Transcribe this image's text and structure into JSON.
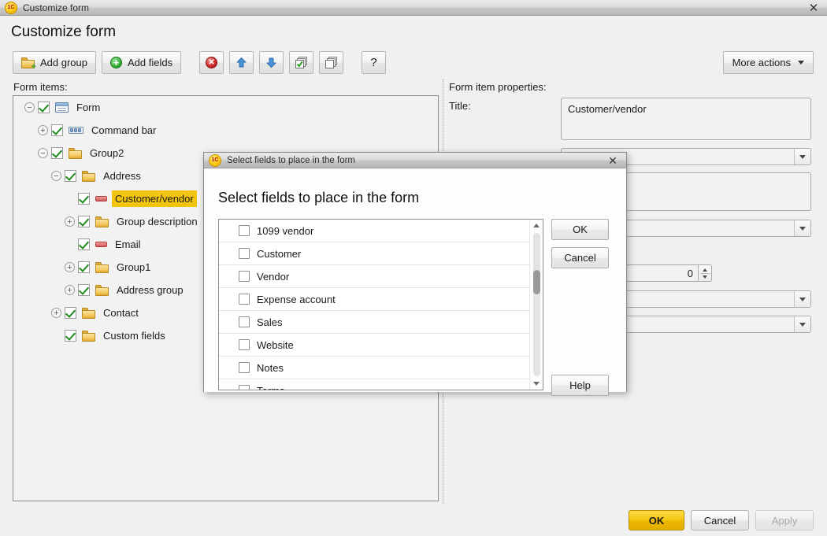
{
  "window": {
    "title": "Customize form",
    "icon": "app-1c-icon",
    "close_label": "✕"
  },
  "page": {
    "heading": "Customize form"
  },
  "toolbar": {
    "buttons": [
      {
        "label": "Add group",
        "icon": "folder-add-icon"
      },
      {
        "label": "Add fields",
        "icon": "plus-circle-icon"
      },
      {
        "label": "",
        "icon": "delete-x-circle-icon"
      },
      {
        "label": "",
        "icon": "move-up-arrow-icon"
      },
      {
        "label": "",
        "icon": "move-down-arrow-icon"
      },
      {
        "label": "",
        "icon": "check-all-pages-icon"
      },
      {
        "label": "",
        "icon": "copy-pages-icon"
      },
      {
        "label": "?",
        "icon": "help-question-icon"
      }
    ],
    "more_actions": "More actions"
  },
  "labels": {
    "form_items": "Form items:",
    "form_item_properties": "Form item properties:",
    "title": "Title:"
  },
  "tree": {
    "items": [
      {
        "label": "Form",
        "indent": 0,
        "twisty": "minus",
        "icon": "form-icon",
        "checked": true,
        "selected": false
      },
      {
        "label": "Command bar",
        "indent": 1,
        "twisty": "plus",
        "icon": "command-bar-icon",
        "checked": true,
        "selected": false
      },
      {
        "label": "Group2",
        "indent": 1,
        "twisty": "minus",
        "icon": "folder-icon",
        "checked": true,
        "selected": false
      },
      {
        "label": "Address",
        "indent": 2,
        "twisty": "minus",
        "icon": "folder-icon",
        "checked": true,
        "selected": false
      },
      {
        "label": "Customer/vendor",
        "indent": 3,
        "twisty": "none",
        "icon": "field-icon",
        "checked": true,
        "selected": true
      },
      {
        "label": "Group description",
        "indent": 3,
        "twisty": "plus",
        "icon": "folder-icon",
        "checked": true,
        "selected": false
      },
      {
        "label": "Email",
        "indent": 3,
        "twisty": "none",
        "icon": "field-icon",
        "checked": true,
        "selected": false
      },
      {
        "label": "Group1",
        "indent": 3,
        "twisty": "plus",
        "icon": "folder-icon",
        "checked": true,
        "selected": false
      },
      {
        "label": "Address group",
        "indent": 3,
        "twisty": "plus",
        "icon": "folder-icon",
        "checked": true,
        "selected": false
      },
      {
        "label": "Contact",
        "indent": 2,
        "twisty": "plus",
        "icon": "folder-icon",
        "checked": true,
        "selected": false
      },
      {
        "label": "Custom fields",
        "indent": 2,
        "twisty": "none",
        "icon": "folder-icon",
        "checked": true,
        "selected": false
      }
    ]
  },
  "properties": {
    "title_value": "Customer/vendor",
    "title_placeholder": "",
    "number_value": "0",
    "combo1_value": "",
    "combo2_value": "",
    "combo3_value": "",
    "combo4_value": "",
    "textbox2_value": ""
  },
  "footer": {
    "ok": "OK",
    "cancel": "Cancel",
    "apply": "Apply"
  },
  "dialog": {
    "titlebar": "Select fields to place in the form",
    "close_label": "✕",
    "heading": "Select fields to place in the form",
    "fields": [
      {
        "label": "1099 vendor",
        "checked": false
      },
      {
        "label": "Customer",
        "checked": false
      },
      {
        "label": "Vendor",
        "checked": false
      },
      {
        "label": "Expense account",
        "checked": false
      },
      {
        "label": "Sales",
        "checked": false
      },
      {
        "label": "Website",
        "checked": false
      },
      {
        "label": "Notes",
        "checked": false
      },
      {
        "label": "Terms",
        "checked": false
      }
    ],
    "buttons": {
      "ok": "OK",
      "cancel": "Cancel",
      "help": "Help"
    },
    "scroll": {
      "thumb_top_pct": 26,
      "thumb_height_pct": 17
    }
  },
  "colors": {
    "selection_highlight": "#f2c50c",
    "primary_button": "#f6c916",
    "window_bg": "#f0f0f0",
    "check_green": "#1e8a1e"
  }
}
